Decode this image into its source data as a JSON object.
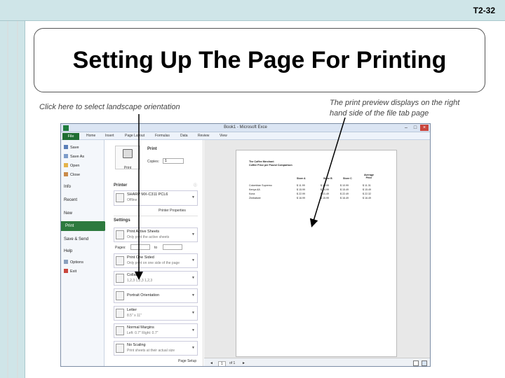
{
  "slide": {
    "number": "T2-32",
    "title": "Setting Up The Page For Printing",
    "callout_left": "Click here to select landscape orientation",
    "callout_right_1": "The print preview displays on the right",
    "callout_right_2": "hand side of the file tab page"
  },
  "window": {
    "title": "Book1 - Microsoft Exce",
    "controls": [
      "–",
      "□",
      "×"
    ]
  },
  "ribbon_tabs": [
    "File",
    "Home",
    "Insert",
    "Page Layout",
    "Formulas",
    "Data",
    "Review",
    "View"
  ],
  "backstage_nav": [
    "Save",
    "Save As",
    "Open",
    "Close",
    "Info",
    "Recent",
    "New",
    "Print",
    "Save & Send",
    "Help",
    "Options",
    "Exit"
  ],
  "print": {
    "heading": "Print",
    "button_label": "Print",
    "copies_label": "Copies:",
    "copies_value": "1",
    "printer_heading": "Printer",
    "printer_name": "SHARP MX-C311 PCL6",
    "printer_status": "Offline",
    "printer_properties": "Printer Properties",
    "settings_heading": "Settings",
    "pages_label": "Pages:",
    "to_label": "to",
    "dropdowns": [
      {
        "line1": "Print Active Sheets",
        "line2": "Only print the active sheets"
      },
      {
        "line1": "Print One Sided",
        "line2": "Only print on one side of the page"
      },
      {
        "line1": "Collated",
        "line2": "1,2,3   1,2,3   1,2,3"
      },
      {
        "line1": "Portrait Orientation",
        "line2": ""
      },
      {
        "line1": "Letter",
        "line2": "8.5\" x 11\""
      },
      {
        "line1": "Normal Margins",
        "line2": "Left: 0.7\"   Right: 0.7\""
      },
      {
        "line1": "No Scaling",
        "line2": "Print sheets at their actual size"
      }
    ],
    "page_setup": "Page Setup"
  },
  "preview": {
    "title_1": "The Coffee Merchant",
    "title_2": "Coffee Price per Pound Comparison",
    "headers": [
      "Store A",
      "Store B",
      "Store C",
      "Average Price"
    ],
    "rows": [
      {
        "name": "Colombian Supremo",
        "values": [
          "$ 11.99",
          "$ 10.95",
          "$ 10.99",
          "$ 11.31"
        ]
      },
      {
        "name": "Kenya AA",
        "values": [
          "$ 15.99",
          "$ 14.99",
          "$ 15.49",
          "$ 15.49"
        ]
      },
      {
        "name": "Kona",
        "values": [
          "$ 22.99",
          "$ 21.49",
          "$ 22.49",
          "$ 22.32"
        ]
      },
      {
        "name": "Zimbabwe",
        "values": [
          "$ 16.99",
          "$ 15.99",
          "$ 16.49",
          "$ 16.49"
        ]
      }
    ],
    "page_nav": "1",
    "page_total": "of 1"
  },
  "colors": {
    "slide_band": "#cfe5e8",
    "excel_green": "#2d7a3e"
  }
}
